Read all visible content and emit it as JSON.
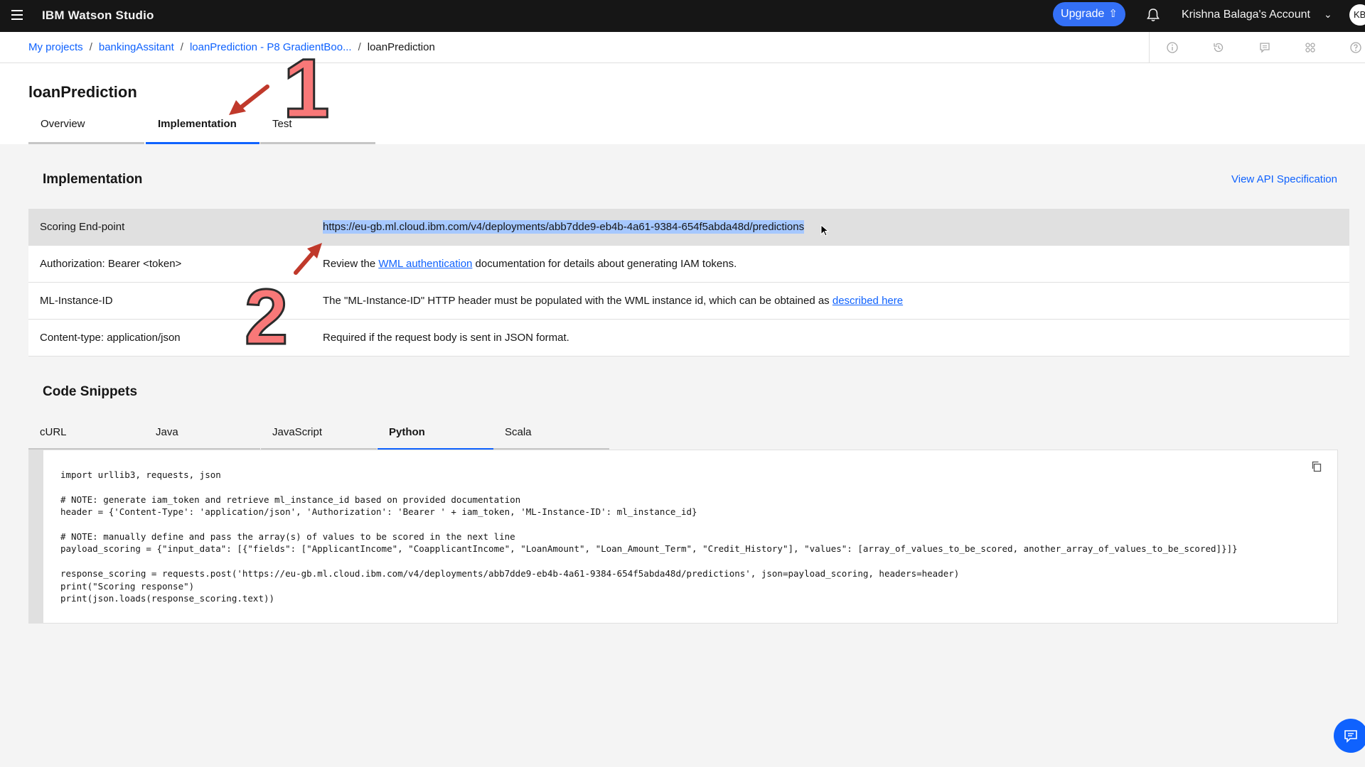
{
  "topbar": {
    "app_title": "IBM Watson Studio",
    "upgrade_label": "Upgrade",
    "account_label": "Krishna Balaga's Account",
    "avatar_initials": "KB"
  },
  "breadcrumb": {
    "items": [
      "My projects",
      "bankingAssitant",
      "loanPrediction - P8 GradientBoo...",
      "loanPrediction"
    ]
  },
  "page": {
    "title": "loanPrediction",
    "tabs": [
      "Overview",
      "Implementation",
      "Test"
    ],
    "active_tab": "Implementation"
  },
  "annotations": {
    "one": "1",
    "two": "2"
  },
  "implementation": {
    "title": "Implementation",
    "view_api_label": "View API Specification",
    "rows": [
      {
        "key": "Scoring End-point",
        "value": "https://eu-gb.ml.cloud.ibm.com/v4/deployments/abb7dde9-eb4b-4a61-9384-654f5abda48d/predictions"
      },
      {
        "key": "Authorization: Bearer <token>",
        "pre": "Review the ",
        "link": "WML authentication",
        "post": " documentation for details about generating IAM tokens."
      },
      {
        "key": "ML-Instance-ID",
        "pre": "The \"ML-Instance-ID\" HTTP header must be populated with the WML instance id, which can be obtained as ",
        "link": "described here"
      },
      {
        "key": "Content-type: application/json",
        "value": "Required if the request body is sent in JSON format."
      }
    ]
  },
  "snippets": {
    "title": "Code Snippets",
    "tabs": [
      "cURL",
      "Java",
      "JavaScript",
      "Python",
      "Scala"
    ],
    "active_tab": "Python",
    "code": "import urllib3, requests, json\n\n# NOTE: generate iam_token and retrieve ml_instance_id based on provided documentation\nheader = {'Content-Type': 'application/json', 'Authorization': 'Bearer ' + iam_token, 'ML-Instance-ID': ml_instance_id}\n\n# NOTE: manually define and pass the array(s) of values to be scored in the next line\npayload_scoring = {\"input_data\": [{\"fields\": [\"ApplicantIncome\", \"CoapplicantIncome\", \"LoanAmount\", \"Loan_Amount_Term\", \"Credit_History\"], \"values\": [array_of_values_to_be_scored, another_array_of_values_to_be_scored]}]}\n\nresponse_scoring = requests.post('https://eu-gb.ml.cloud.ibm.com/v4/deployments/abb7dde9-eb4b-4a61-9384-654f5abda48d/predictions', json=payload_scoring, headers=header)\nprint(\"Scoring response\")\nprint(json.loads(response_scoring.text))"
  },
  "colors": {
    "accent": "#0f62fe",
    "topbar": "#161616",
    "upgrade": "#3470f6",
    "annotation": "#f87878"
  }
}
